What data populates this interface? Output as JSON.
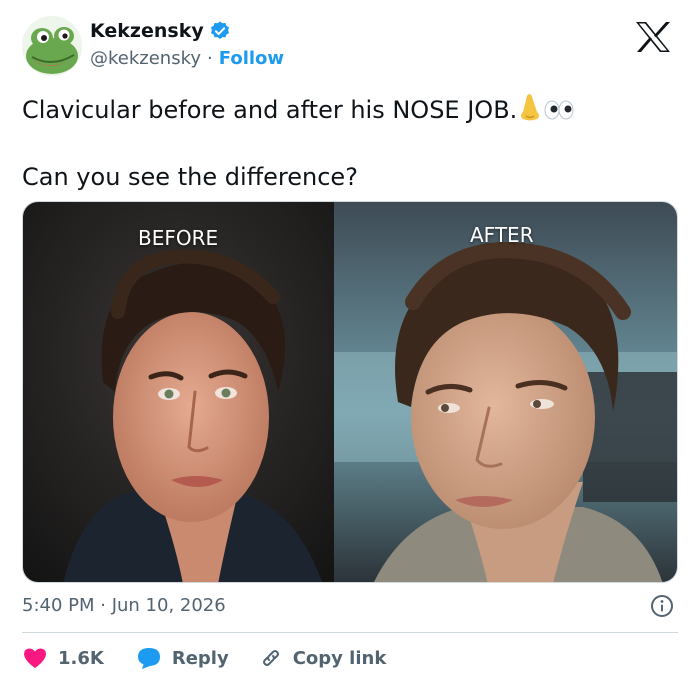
{
  "author": {
    "display_name": "Kekzensky",
    "handle": "@kekzensky",
    "separator": "·",
    "follow_label": "Follow",
    "verified": true
  },
  "platform_icon": "x-logo-icon",
  "tweet": {
    "line1": "Clavicular before and after his NOSE JOB.",
    "line1_emojis": [
      "nose-emoji",
      "eyes-emoji"
    ],
    "line2": "Can you see the difference?"
  },
  "media": {
    "label_before": "BEFORE",
    "label_after": "AFTER"
  },
  "timestamp": "5:40 PM · Jun 10, 2026",
  "actions": {
    "like_count": "1.6K",
    "reply_label": "Reply",
    "copy_link_label": "Copy link"
  },
  "colors": {
    "accent": "#1d9bf0",
    "like": "#f91880",
    "text": "#0f1419",
    "muted": "#536471",
    "border": "#cfd9de"
  }
}
